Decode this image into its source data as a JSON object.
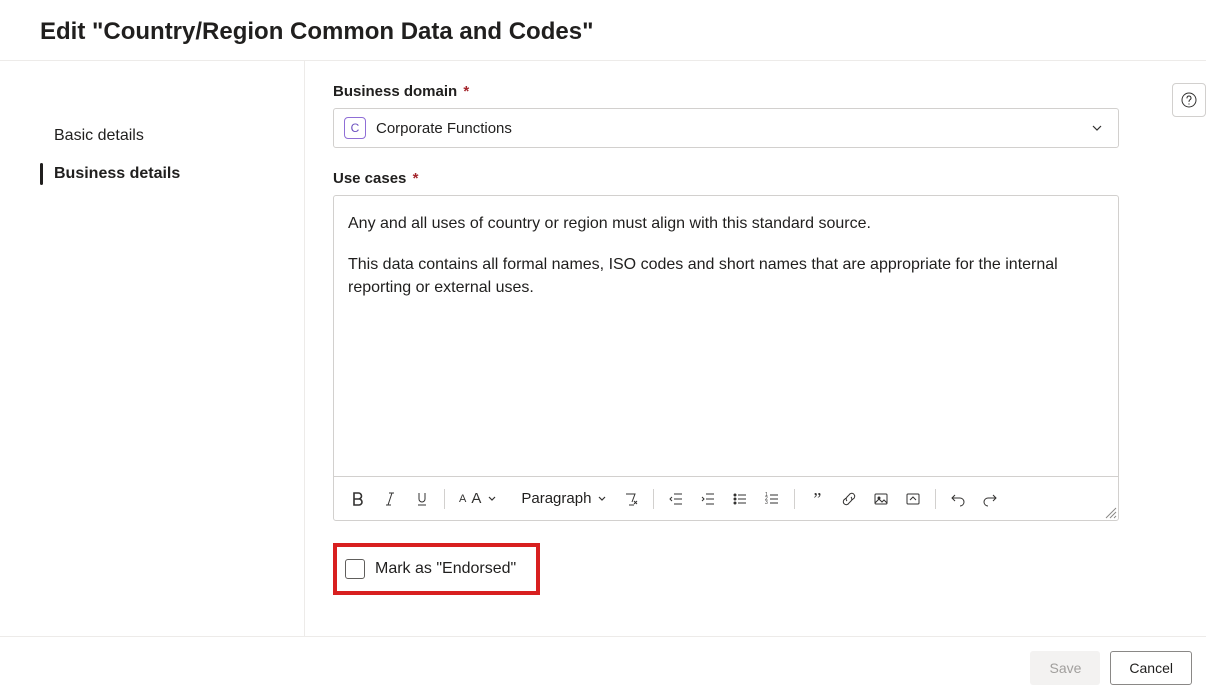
{
  "header": {
    "title": "Edit \"Country/Region Common Data and Codes\""
  },
  "nav": {
    "items": [
      {
        "label": "Basic details",
        "active": false
      },
      {
        "label": "Business details",
        "active": true
      }
    ]
  },
  "form": {
    "business_domain": {
      "label": "Business domain",
      "required": true,
      "chip_letter": "C",
      "value": "Corporate Functions"
    },
    "use_cases": {
      "label": "Use cases",
      "required": true,
      "paragraphs": [
        "Any and all uses of country or region must align with this standard source.",
        "This data contains all formal names, ISO codes and short names that are appropriate for the internal reporting or external uses."
      ]
    },
    "editor_toolbar": {
      "paragraph_select": "Paragraph"
    },
    "endorsed": {
      "label": "Mark as \"Endorsed\"",
      "checked": false
    }
  },
  "footer": {
    "save": "Save",
    "cancel": "Cancel"
  }
}
